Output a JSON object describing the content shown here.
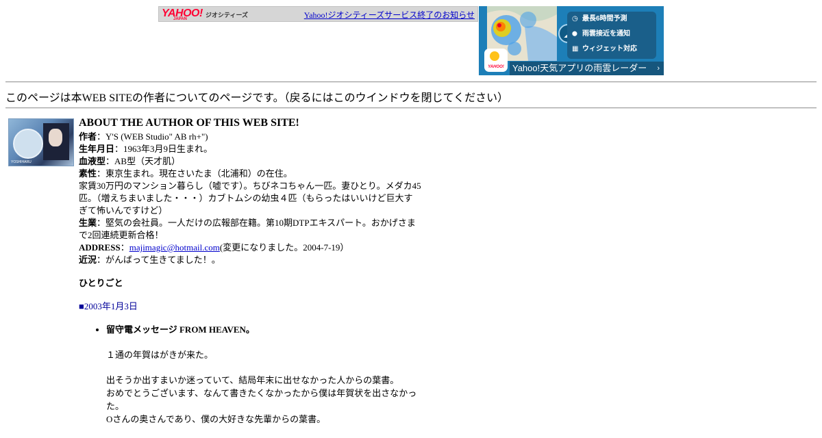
{
  "banner": {
    "logo": "YAHOO!",
    "logo_sub": "JAPAN",
    "service_name": "ジオシティーズ",
    "notice_link": "Yahoo!ジオシティーズサービス終了のお知らせ"
  },
  "ad": {
    "features": [
      {
        "icon": "clock-icon",
        "glyph": "◷",
        "label": "最長6時間予測"
      },
      {
        "icon": "location-pin-icon",
        "glyph": "⬤",
        "label": "雨雲接近を通知"
      },
      {
        "icon": "widget-icon",
        "glyph": "▦",
        "label": "ウィジェット対応"
      }
    ],
    "app_label": "YAHOO!",
    "cta": "Yahoo!天気アプリの雨雲レーダー",
    "cta_chevron": "›"
  },
  "page_note": "このページは本WEB SITEの作者についてのページです。（戻るにはこのウインドウを閉じてください）",
  "profile": {
    "thumbnail_caption": "YOSHIHARU",
    "title": "ABOUT THE AUTHOR OF THIS WEB SITE!",
    "author_label": "作者",
    "author_value": "：Y'S (WEB Studio\" AB rh+\")",
    "birthday_label": "生年月日",
    "birthday_value": "：1963年3月9日生まれ。",
    "blood_label": "血液型",
    "blood_value": "：AB型（天才肌）",
    "background_label": "素性",
    "background_value": "：東京生まれ。現在さいたま（北浦和）の在住。",
    "background_extra": "家賃30万円のマンション暮らし（嘘です）。ちびネコちゃん一匹。妻ひとり。メダカ45匹。（増えちまいました・・・）カブトムシの幼虫４匹（もらったはいいけど巨大すぎて怖いんですけど）",
    "job_label": "生業",
    "job_value": "：堅気の会社員。一人だけの広報部在籍。第10期DTPエキスパート。おかげさまで2回連続更新合格！",
    "address_label": "ADDRESS",
    "address_sep": "：",
    "address_email": "majimagic@hotmail.com",
    "address_note": "(変更になりました。2004-7-19）",
    "recent_label": "近況",
    "recent_value": "：がんばって生きてました！。"
  },
  "monologue": {
    "heading": "ひとりごと",
    "date": "■2003年1月3日",
    "entry_title": "留守電メッセージ FROM HEAVEN。",
    "paragraphs": [
      "１通の年賀はがきが来た。",
      "出そうか出すまいか迷っていて、結局年末に出せなかった人からの葉書。\nおめでとうございます、なんて書きたくなかったから僕は年賀状を出さなかった。\nOさんの奥さんであり、僕の大好きな先輩からの葉書。"
    ]
  }
}
